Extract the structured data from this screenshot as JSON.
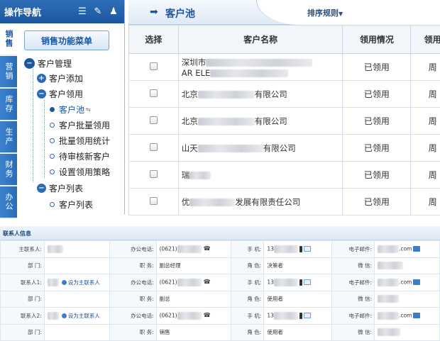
{
  "nav": {
    "title": "操作导航",
    "icons": [
      "list-icon",
      "tools-icon",
      "user-icon"
    ],
    "vertical_tabs": [
      "销售",
      "营销",
      "库存",
      "生产",
      "财务",
      "办公"
    ],
    "menu_button": "销售功能菜单",
    "tree": {
      "customer_mgmt": "客户管理",
      "customer_add": "客户添加",
      "customer_claim": "客户领用",
      "customer_pool": "客户池",
      "batch_claim": "客户批量领用",
      "batch_stats": "批量领用统计",
      "pending_review": "待审核新客户",
      "claim_policy": "设置领用策略",
      "customer_list_group": "客户列表",
      "customer_list": "客户列表"
    }
  },
  "main": {
    "breadcrumb": "客户池",
    "sort_rule": "排序规则",
    "columns": [
      "选择",
      "客户名称",
      "领用情况",
      "领用"
    ],
    "rows": [
      {
        "name_prefix": "深圳市",
        "name_suffix": "",
        "line2": "AR ELE",
        "status": "已领用",
        "period": "周"
      },
      {
        "name_prefix": "北京",
        "name_suffix": "有限公司",
        "line2": "",
        "status": "已领用",
        "period": "周"
      },
      {
        "name_prefix": "北京",
        "name_suffix": "有限公司",
        "line2": "",
        "status": "已领用",
        "period": "周"
      },
      {
        "name_prefix": "山天",
        "name_suffix": "有限公司",
        "line2": "",
        "status": "已领用",
        "period": "周"
      },
      {
        "name_prefix": "瑞",
        "name_suffix": "",
        "line2": "",
        "status": "已领用",
        "period": "周"
      },
      {
        "name_prefix": "优",
        "name_suffix": "发展有限责任公司",
        "line2": "",
        "status": "已领用",
        "period": "周"
      }
    ]
  },
  "contact": {
    "title": "联系人信息",
    "labels": {
      "main_contact": "主联系人:",
      "contact1": "联系人1:",
      "contact2": "联系人2:",
      "dept": "部  门:",
      "office_phone": "办公电话:",
      "position": "职  务:",
      "mobile": "手  机:",
      "role": "角  色:",
      "email": "电子邮件:",
      "wechat": "微  信:"
    },
    "phone_prefix": "(0621)",
    "mobile_prefix": "13",
    "set_main": "设为主联系人",
    "email_suffix": ".com",
    "main": {
      "position": "副总经理",
      "role": "决策者"
    },
    "c1": {
      "position": "副总",
      "role": "使用者"
    },
    "c2": {
      "position": "销售",
      "role": "使用者"
    }
  }
}
